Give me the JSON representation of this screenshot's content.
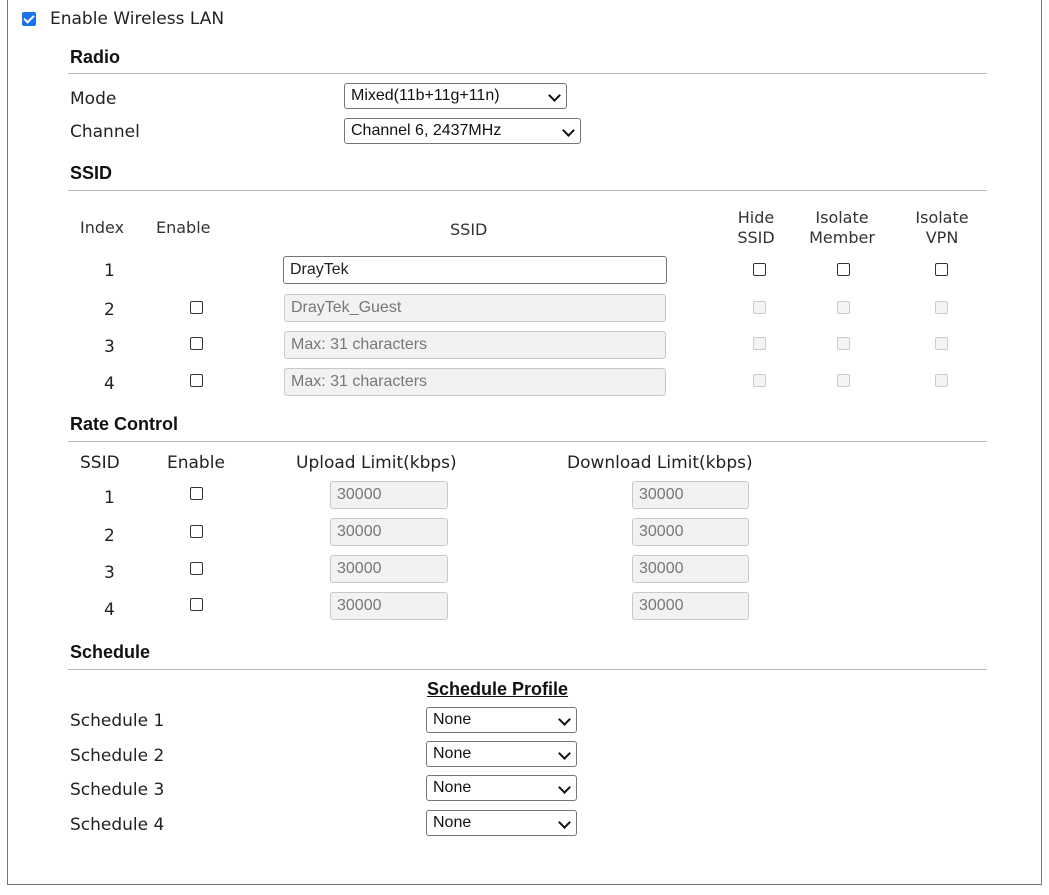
{
  "enable_wireless": {
    "label": "Enable Wireless LAN",
    "checked": true
  },
  "radio": {
    "title": "Radio",
    "mode_label": "Mode",
    "mode_value": "Mixed(11b+11g+11n)",
    "channel_label": "Channel",
    "channel_value": "Channel 6, 2437MHz"
  },
  "ssid": {
    "title": "SSID",
    "headers": {
      "index": "Index",
      "enable": "Enable",
      "ssid": "SSID",
      "hide": "Hide SSID",
      "isolate_member": "Isolate Member",
      "isolate_vpn": "Isolate VPN"
    },
    "rows": [
      {
        "index": "1",
        "value": "DrayTek",
        "placeholder": "",
        "enabled": true
      },
      {
        "index": "2",
        "value": "DrayTek_Guest",
        "placeholder": "",
        "enabled": false
      },
      {
        "index": "3",
        "value": "",
        "placeholder": "Max: 31 characters",
        "enabled": false
      },
      {
        "index": "4",
        "value": "",
        "placeholder": "Max: 31 characters",
        "enabled": false
      }
    ]
  },
  "rate_control": {
    "title": "Rate Control",
    "headers": {
      "ssid": "SSID",
      "enable": "Enable",
      "upload": "Upload Limit(kbps)",
      "download": "Download Limit(kbps)"
    },
    "rows": [
      {
        "ssid": "1",
        "upload": "30000",
        "download": "30000"
      },
      {
        "ssid": "2",
        "upload": "30000",
        "download": "30000"
      },
      {
        "ssid": "3",
        "upload": "30000",
        "download": "30000"
      },
      {
        "ssid": "4",
        "upload": "30000",
        "download": "30000"
      }
    ]
  },
  "schedule": {
    "title": "Schedule",
    "profile_header": "Schedule Profile",
    "rows": [
      {
        "label": "Schedule 1",
        "value": "None"
      },
      {
        "label": "Schedule 2",
        "value": "None"
      },
      {
        "label": "Schedule 3",
        "value": "None"
      },
      {
        "label": "Schedule 4",
        "value": "None"
      }
    ]
  },
  "colors": {
    "accent": "#1a73e8",
    "rule": "#bbbbbb",
    "disabled_bg": "#f2f2f2"
  }
}
